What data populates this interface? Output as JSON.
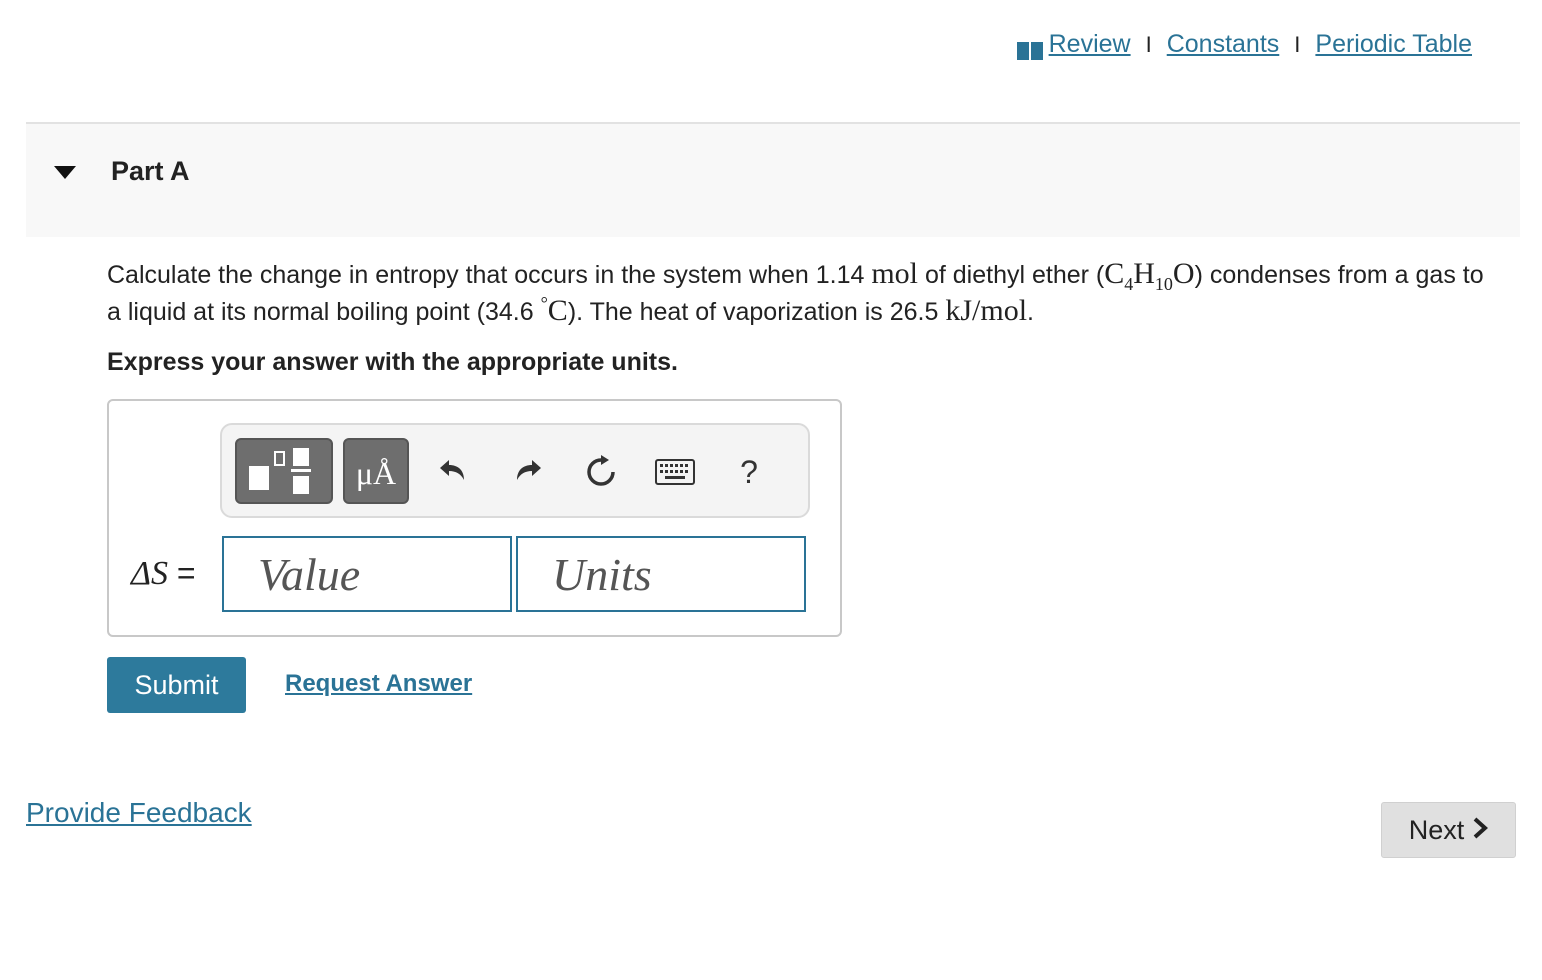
{
  "top_links": {
    "review": "Review",
    "separator": "I",
    "constants": "Constants",
    "periodic_table": "Periodic Table",
    "icon": "book-icon"
  },
  "part": {
    "title": "Part A",
    "icon": "caret-down-icon"
  },
  "question": {
    "text_1": "Calculate the change in entropy that occurs in the system when 1.14 ",
    "unit_mol": "mol",
    "text_2": " of diethyl ether (",
    "formula_c": "C",
    "formula_c_sub": "4",
    "formula_h": "H",
    "formula_h_sub": "10",
    "formula_o": "O",
    "text_3": ") condenses from a gas to a liquid at its normal boiling point (34.6 ",
    "degree": "°",
    "unit_c": "C",
    "text_4": "). The heat of vaporization is 26.5 ",
    "unit_kj_mol": "kJ/mol",
    "text_5": "."
  },
  "instruction": "Express your answer with the appropriate units.",
  "toolbar": {
    "templates_icon": "templates-icon",
    "units_label": "μÅ",
    "undo_icon": "undo-icon",
    "redo_icon": "redo-icon",
    "reset_icon": "reset-icon",
    "keyboard_icon": "keyboard-icon",
    "help_label": "?"
  },
  "answer": {
    "lhs_symbol": "ΔS",
    "equals": "=",
    "value_placeholder": "Value",
    "units_placeholder": "Units"
  },
  "actions": {
    "submit_label": "Submit",
    "request_answer_label": "Request Answer",
    "provide_feedback_label": "Provide Feedback",
    "next_label": "Next",
    "next_icon": "chevron-right-icon"
  },
  "colors": {
    "link": "#2a7396",
    "submit_bg": "#2d7a9c",
    "next_bg": "#e0e0e0",
    "header_bg": "#f8f8f8"
  }
}
